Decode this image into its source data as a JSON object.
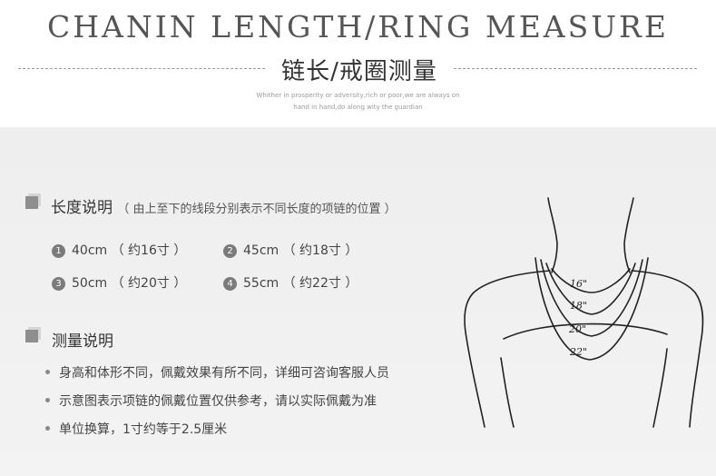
{
  "header": {
    "title_en": "CHANIN LENGTH/RING MEASURE",
    "title_cn": "链长/戒圈测量",
    "subtitle_line1": "Whither in prosperity or adversity,rich or poor,we are  always on",
    "subtitle_line2": "hand in hand,do along wity the guardian"
  },
  "length_section": {
    "title": "长度说明",
    "note": "（ 由上至下的线段分别表示不同长度的项链的位置 ）",
    "items": [
      {
        "num": "1",
        "text": "40cm （ 约16寸 ）"
      },
      {
        "num": "2",
        "text": "45cm （ 约18寸 ）"
      },
      {
        "num": "3",
        "text": "50cm （ 约20寸 ）"
      },
      {
        "num": "4",
        "text": "55cm （ 约22寸 ）"
      }
    ]
  },
  "measure_section": {
    "title": "测量说明",
    "bullets": [
      "身高和体形不同，佩戴效果有所不同，详细可咨询客服人员",
      "示意图表示项链的佩戴位置仅供参考，请以实际佩戴为准",
      "单位换算，1寸约等于2.5厘米"
    ]
  },
  "diagram": {
    "labels": [
      "16\"",
      "18\"",
      "20\"",
      "22\""
    ]
  }
}
